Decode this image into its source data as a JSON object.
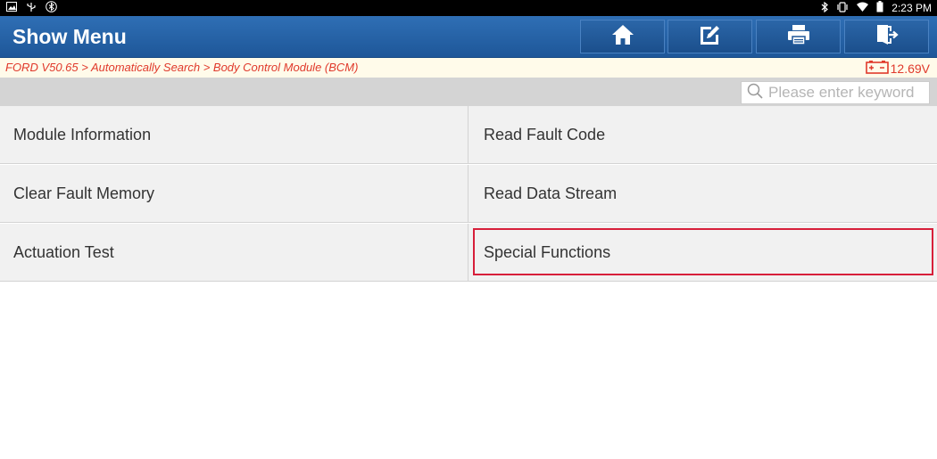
{
  "statusbar": {
    "time": "2:23 PM",
    "icons": [
      "image-icon",
      "usb-icon",
      "bluetooth-circle-icon",
      "bluetooth-icon",
      "vibrate-icon",
      "wifi-icon",
      "battery-icon"
    ]
  },
  "header": {
    "title": "Show Menu",
    "buttons": [
      "home-icon",
      "edit-icon",
      "print-icon",
      "exit-icon"
    ],
    "color": "#1e5799"
  },
  "breadcrumb": {
    "text": "FORD V50.65 > Automatically Search > Body Control Module (BCM)",
    "color": "#e0392b"
  },
  "voltage": {
    "value": "12.69V"
  },
  "search": {
    "placeholder": "Please enter keyword"
  },
  "menu": {
    "items": [
      {
        "label": "Module Information"
      },
      {
        "label": "Read Fault Code"
      },
      {
        "label": "Clear Fault Memory"
      },
      {
        "label": "Read Data Stream"
      },
      {
        "label": "Actuation Test"
      },
      {
        "label": "Special Functions",
        "selected": true
      }
    ],
    "highlight_color": "#d71f3a"
  }
}
